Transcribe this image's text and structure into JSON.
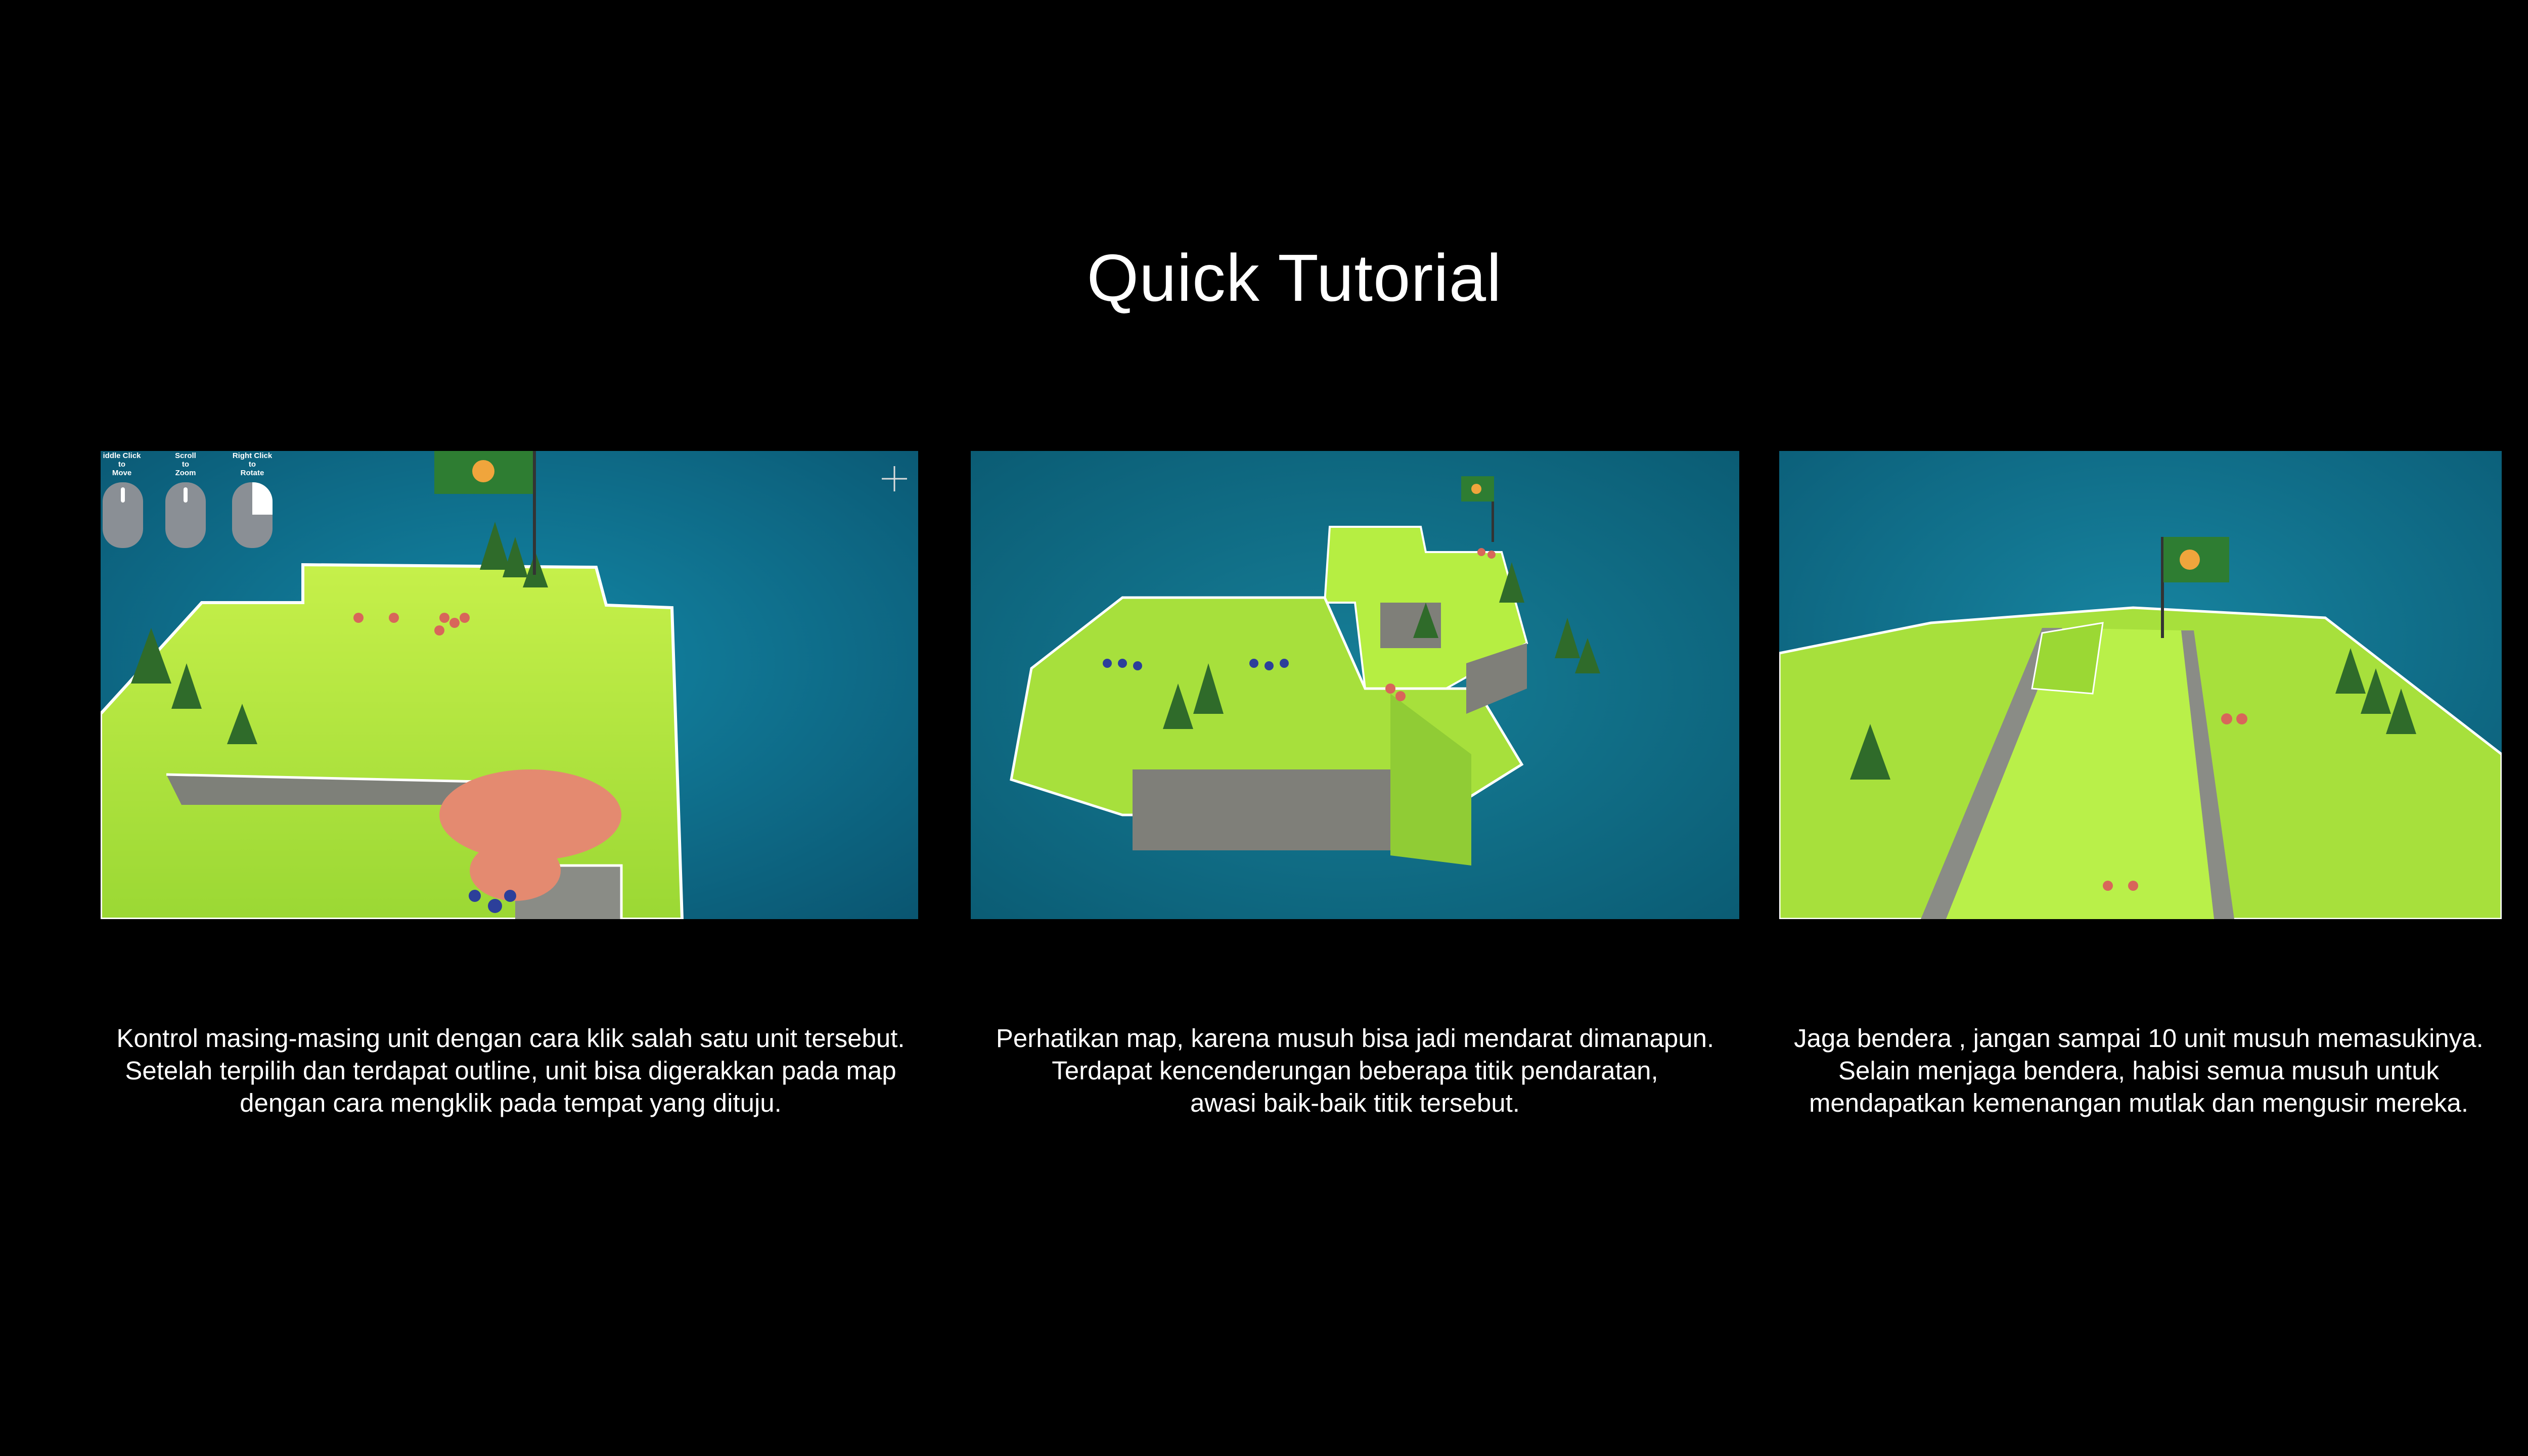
{
  "page": {
    "title": "Quick Tutorial",
    "background_color": "#000000",
    "text_color": "#ffffff"
  },
  "shots": [
    {
      "name": "tutorial-shot-unit-control",
      "hud": {
        "hints": [
          {
            "lines": [
              "iddle Click",
              "to",
              "Move"
            ],
            "icon": "mouse-middle-click-icon"
          },
          {
            "lines": [
              "Scroll",
              "to",
              "Zoom"
            ],
            "icon": "mouse-scroll-icon"
          },
          {
            "lines": [
              "Right Click",
              "to",
              "Rotate"
            ],
            "icon": "mouse-right-click-icon"
          }
        ],
        "compass_icon": "compass-icon"
      }
    },
    {
      "name": "tutorial-shot-landing-points"
    },
    {
      "name": "tutorial-shot-guard-flag"
    }
  ],
  "captions": [
    {
      "lines": [
        "Kontrol masing-masing unit dengan cara klik salah satu unit tersebut.",
        "Setelah terpilih dan terdapat outline, unit bisa digerakkan pada map",
        "dengan cara mengklik pada tempat yang dituju."
      ]
    },
    {
      "lines": [
        "Perhatikan  map, karena musuh bisa jadi mendarat dimanapun.",
        "Terdapat kencenderungan beberapa titik pendaratan,",
        "awasi baik-baik titik tersebut."
      ]
    },
    {
      "lines": [
        "Jaga bendera , jangan sampai 10 unit musuh memasukinya.",
        "Selain menjaga bendera, habisi semua musuh untuk",
        "mendapatkan kemenangan mutlak dan mengusir mereka."
      ]
    }
  ],
  "colors": {
    "sea": "#0f6c8c",
    "grass": "#a7e03c",
    "cliff": "#7e8079",
    "tree": "#2f6b2a",
    "flag": "#2e7d32",
    "enemy_unit": "#e48a70",
    "ally_unit": "#2c3f9a"
  }
}
